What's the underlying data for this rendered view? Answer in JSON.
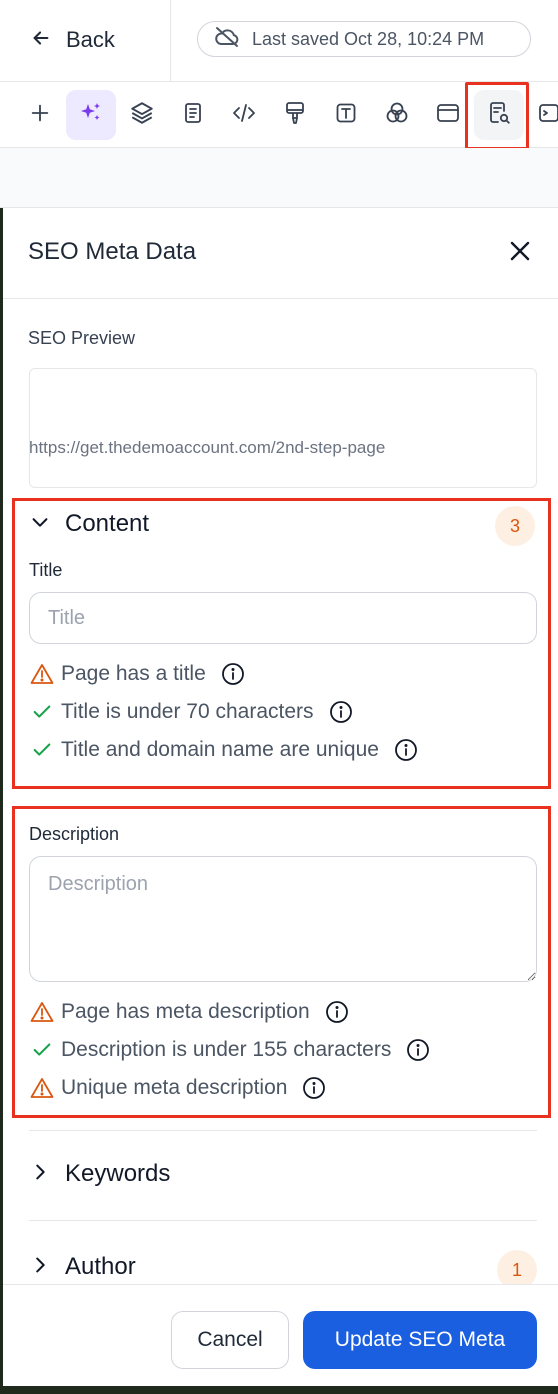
{
  "header": {
    "back_label": "Back",
    "saved_status": "Last saved Oct 28, 10:24 PM"
  },
  "toolbar": {
    "tools": [
      {
        "icon": "plus-icon"
      },
      {
        "icon": "sparkles-icon",
        "state": "active"
      },
      {
        "icon": "layers-icon"
      },
      {
        "icon": "page-icon"
      },
      {
        "icon": "code-icon"
      },
      {
        "icon": "paint-brush-icon"
      },
      {
        "icon": "text-icon"
      },
      {
        "icon": "color-circles-icon"
      },
      {
        "icon": "browser-window-icon"
      },
      {
        "icon": "seo-search-doc-icon",
        "state": "current"
      },
      {
        "icon": "terminal-icon"
      }
    ]
  },
  "panel": {
    "title": "SEO Meta Data",
    "seo_preview": {
      "label": "SEO Preview",
      "url": "https://get.thedemoaccount.com/2nd-step-page"
    },
    "content": {
      "heading": "Content",
      "badge": "3",
      "title_label": "Title",
      "title_placeholder": "Title",
      "title_value": "",
      "title_checks": [
        {
          "status": "warning",
          "text": "Page has a title"
        },
        {
          "status": "pass",
          "text": "Title is under 70 characters"
        },
        {
          "status": "pass",
          "text": "Title and domain name are unique"
        }
      ],
      "description_label": "Description",
      "description_placeholder": "Description",
      "description_value": "",
      "description_checks": [
        {
          "status": "warning",
          "text": "Page has meta description"
        },
        {
          "status": "pass",
          "text": "Description is under 155 characters"
        },
        {
          "status": "warning",
          "text": "Unique meta description"
        }
      ]
    },
    "keywords": {
      "heading": "Keywords"
    },
    "author": {
      "heading": "Author",
      "badge": "1"
    }
  },
  "footer": {
    "cancel_label": "Cancel",
    "primary_label": "Update SEO Meta"
  },
  "colors": {
    "accent_blue": "#1a5fe0",
    "active_purple": "#7c3aed",
    "warning_orange": "#d9570f",
    "pass_green": "#16a34a",
    "highlight_red": "#e8321f"
  }
}
